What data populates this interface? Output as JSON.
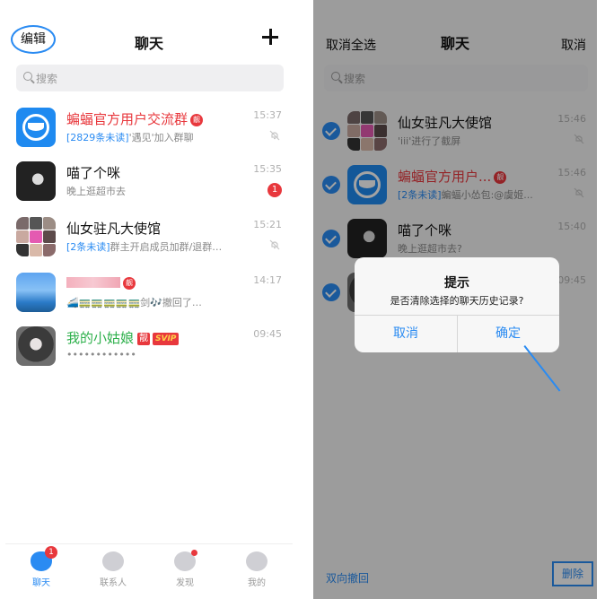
{
  "left": {
    "header": {
      "edit_label": "编辑",
      "title": "聊天"
    },
    "search": {
      "placeholder": "搜索"
    },
    "chats": [
      {
        "name": "蝙蝠官方用户交流群",
        "tag": "靓",
        "unread": "[2829条未读]",
        "preview": "'遇见'加入群聊",
        "time": "15:37"
      },
      {
        "name": "喵了个咪",
        "preview": "晚上逛超市去",
        "time": "15:35",
        "badge": "1"
      },
      {
        "name": "仙女驻凡大使馆",
        "unread": "[2条未读]",
        "preview": "群主开启成员加群/退群…",
        "time": "15:21"
      },
      {
        "name": "",
        "tag": "靓",
        "preview": "🚄🚃🚃🚃🚃🚃剑🎶撤回了…",
        "time": "14:17"
      },
      {
        "name": "我的小姑娘",
        "tag": "靓",
        "svip": "SVIP",
        "preview": "••••••••••••",
        "time": "09:45"
      }
    ],
    "tabs": [
      {
        "label": "聊天",
        "badge": "1"
      },
      {
        "label": "联系人"
      },
      {
        "label": "发现"
      },
      {
        "label": "我的"
      }
    ]
  },
  "right": {
    "header": {
      "select_all": "取消全选",
      "title": "聊天",
      "cancel": "取消"
    },
    "search": {
      "placeholder": "搜索"
    },
    "chats": [
      {
        "name": "仙女驻凡大使馆",
        "preview": "'iii'进行了截屏",
        "time": "15:46"
      },
      {
        "name": "蝙蝠官方用户...",
        "tag": "靓",
        "unread": "[2条未读]",
        "preview": "蝙蝠小怂包:@虞姬...",
        "time": "15:46"
      },
      {
        "name": "喵了个咪",
        "preview": "晚上逛超市去?",
        "time": "15:40"
      },
      {
        "name": "",
        "preview": "",
        "time": "09:45"
      }
    ],
    "dialog": {
      "title": "提示",
      "message": "是否清除选择的聊天历史记录?",
      "cancel": "取消",
      "confirm": "确定"
    },
    "bottom": {
      "revoke": "双向撤回",
      "delete": "删除"
    }
  },
  "colors": {
    "accent": "#2a8bf2",
    "alert": "#e8383d",
    "green": "#2db04b"
  }
}
